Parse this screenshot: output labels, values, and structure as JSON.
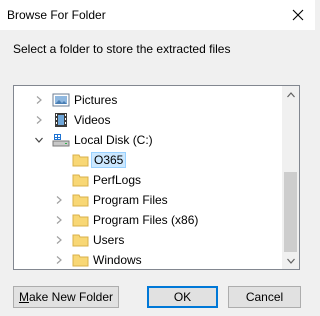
{
  "window": {
    "title": "Browse For Folder"
  },
  "prompt": "Select a folder to store the extracted files",
  "tree": {
    "items": [
      {
        "label": "Pictures",
        "expander": "collapsed",
        "icon": "pictures-icon"
      },
      {
        "label": "Videos",
        "expander": "collapsed",
        "icon": "videos-icon"
      },
      {
        "label": "Local Disk (C:)",
        "expander": "expanded",
        "icon": "drive-icon"
      },
      {
        "label": "O365",
        "expander": "none",
        "icon": "folder-icon",
        "selected": true
      },
      {
        "label": "PerfLogs",
        "expander": "none",
        "icon": "folder-icon"
      },
      {
        "label": "Program Files",
        "expander": "collapsed",
        "icon": "folder-icon"
      },
      {
        "label": "Program Files (x86)",
        "expander": "collapsed",
        "icon": "folder-icon"
      },
      {
        "label": "Users",
        "expander": "collapsed",
        "icon": "folder-icon"
      },
      {
        "label": "Windows",
        "expander": "collapsed",
        "icon": "folder-icon"
      }
    ]
  },
  "buttons": {
    "make_new_folder_prefix": "M",
    "make_new_folder_rest": "ake New Folder",
    "ok": "OK",
    "cancel": "Cancel"
  },
  "colors": {
    "selection": "#cce8ff",
    "folder": "#f8d775",
    "default_button_border": "#0078d7"
  }
}
